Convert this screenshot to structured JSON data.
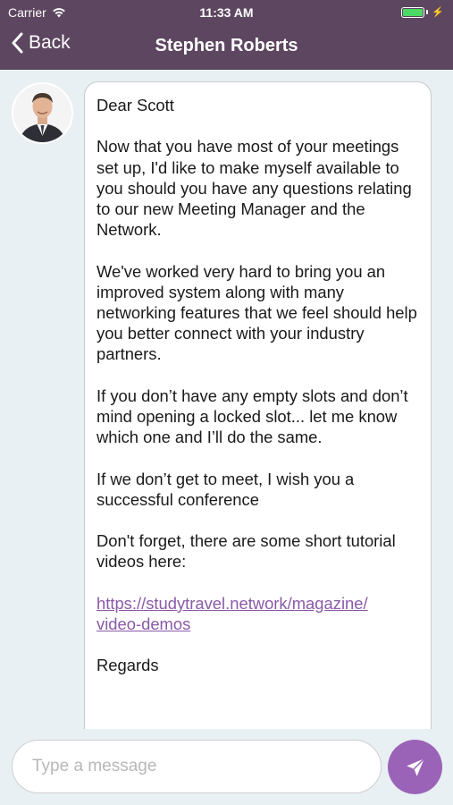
{
  "status_bar": {
    "carrier": "Carrier",
    "time": "11:33 AM",
    "battery_level": 1.0
  },
  "nav": {
    "back_label": "Back",
    "title": "Stephen Roberts"
  },
  "message": {
    "greeting": "Dear Scott",
    "paragraphs": [
      "Now that you have most of your meetings set up, I'd like to make myself available to you should you have any questions relating to our new Meeting Manager and the Network.",
      "We've worked very hard to bring you an improved system along with many networking features that we feel should help you better connect with your industry partners.",
      "If you don’t have any empty slots and don’t mind opening a locked slot... let me know which one and I’ll do the same.",
      "If we don’t get to meet, I wish you a successful conference",
      "Don't forget, there are some short tutorial videos here:"
    ],
    "link_line1": "https://studytravel.network/magazine/",
    "link_line2": "video-demos",
    "signoff": "Regards"
  },
  "composer": {
    "placeholder": "Type a message"
  },
  "colors": {
    "header": "#5d4660",
    "accent": "#9b63b8",
    "link": "#8a5aa8",
    "background": "#e8f0f3"
  },
  "icons": {
    "back": "chevron-left-icon",
    "send": "send-icon",
    "wifi": "wifi-icon",
    "battery": "battery-icon"
  }
}
